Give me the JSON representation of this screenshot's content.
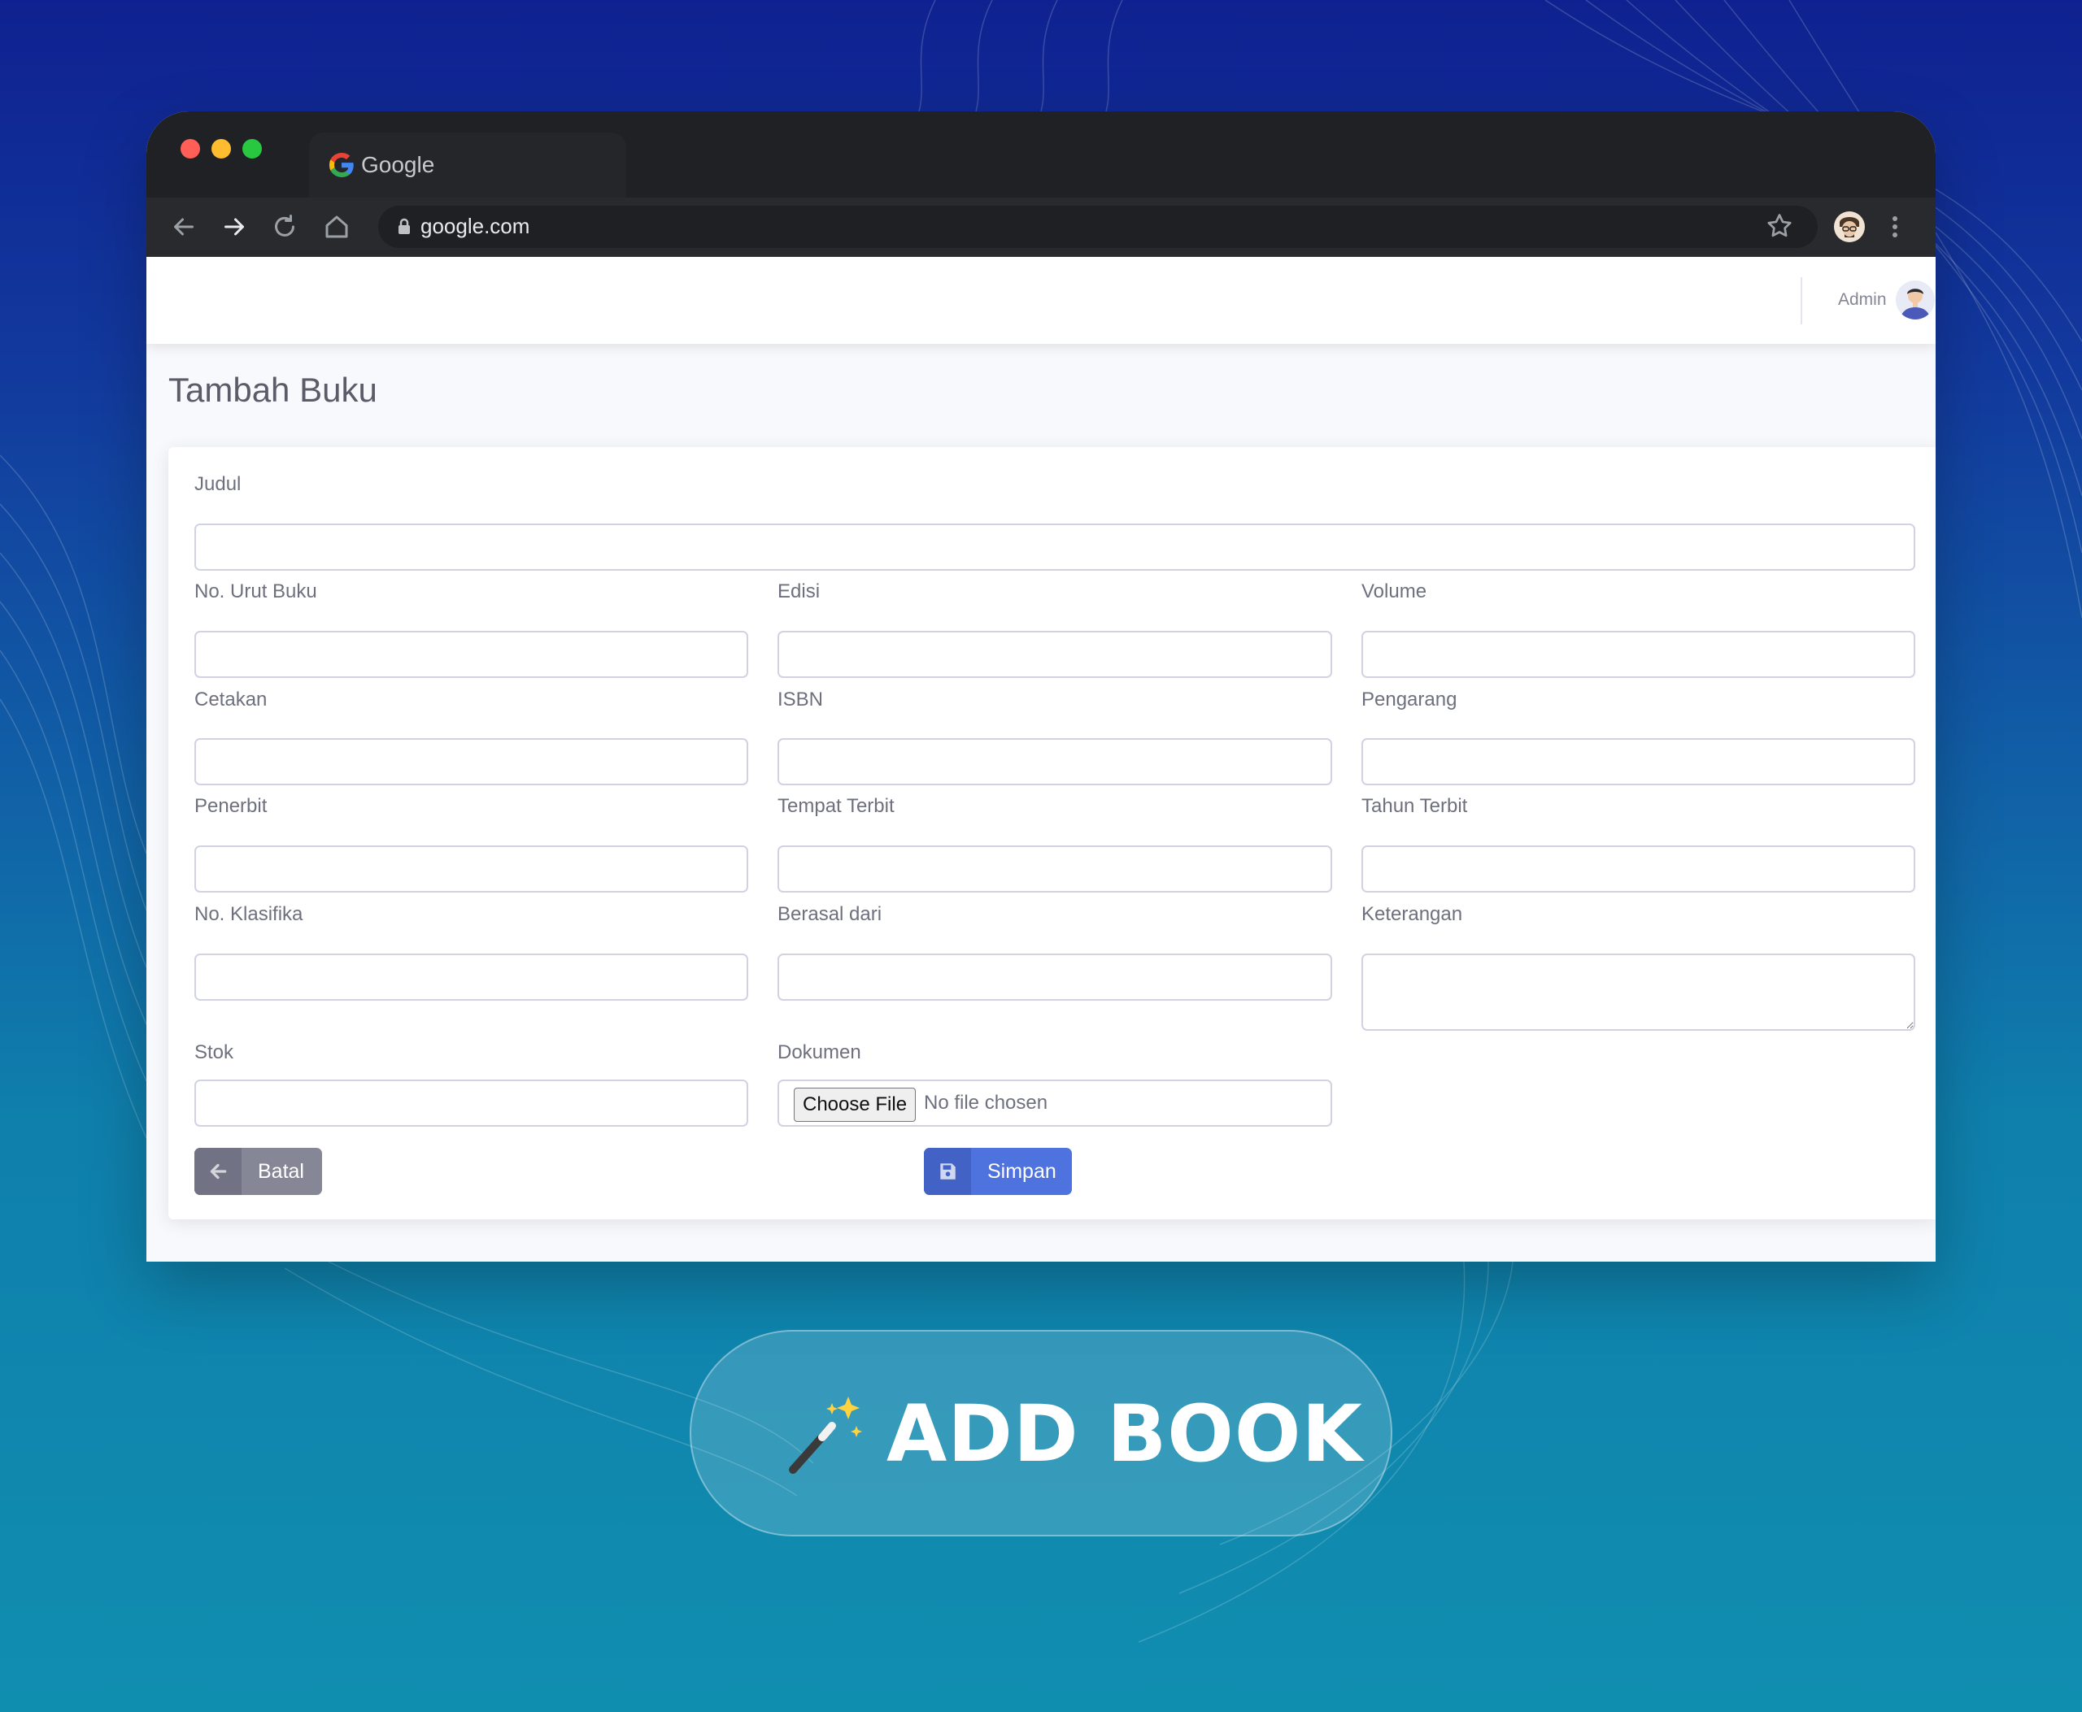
{
  "browser": {
    "tab_title": "Google",
    "url": "google.com"
  },
  "topbar": {
    "user_name": "Admin"
  },
  "page": {
    "title": "Tambah Buku"
  },
  "form": {
    "fields": {
      "judul": {
        "label": "Judul",
        "value": ""
      },
      "no_urut_buku": {
        "label": "No. Urut Buku",
        "value": ""
      },
      "edisi": {
        "label": "Edisi",
        "value": ""
      },
      "volume": {
        "label": "Volume",
        "value": ""
      },
      "cetakan": {
        "label": "Cetakan",
        "value": ""
      },
      "isbn": {
        "label": "ISBN",
        "value": ""
      },
      "pengarang": {
        "label": "Pengarang",
        "value": ""
      },
      "penerbit": {
        "label": "Penerbit",
        "value": ""
      },
      "tempat_terbit": {
        "label": "Tempat Terbit",
        "value": ""
      },
      "tahun_terbit": {
        "label": "Tahun Terbit",
        "value": ""
      },
      "no_klasifika": {
        "label": "No. Klasifika",
        "value": ""
      },
      "berasal_dari": {
        "label": "Berasal dari",
        "value": ""
      },
      "keterangan": {
        "label": "Keterangan",
        "value": ""
      },
      "stok": {
        "label": "Stok",
        "value": ""
      },
      "dokumen": {
        "label": "Dokumen",
        "button_label": "Choose File",
        "status": "No file chosen"
      }
    },
    "buttons": {
      "cancel_label": "Batal",
      "save_label": "Simpan"
    }
  },
  "banner": {
    "text": "ADD BOOK"
  },
  "colors": {
    "primary": "#4e73df",
    "secondary": "#858796",
    "chrome_dark": "#202124"
  },
  "icons": [
    "google-logo",
    "back-arrow-icon",
    "forward-arrow-icon",
    "reload-icon",
    "home-icon",
    "lock-icon",
    "star-icon",
    "profile-icon",
    "menu-icon",
    "user-avatar",
    "arrow-left-icon",
    "floppy-disk-icon",
    "magic-wand-icon"
  ]
}
